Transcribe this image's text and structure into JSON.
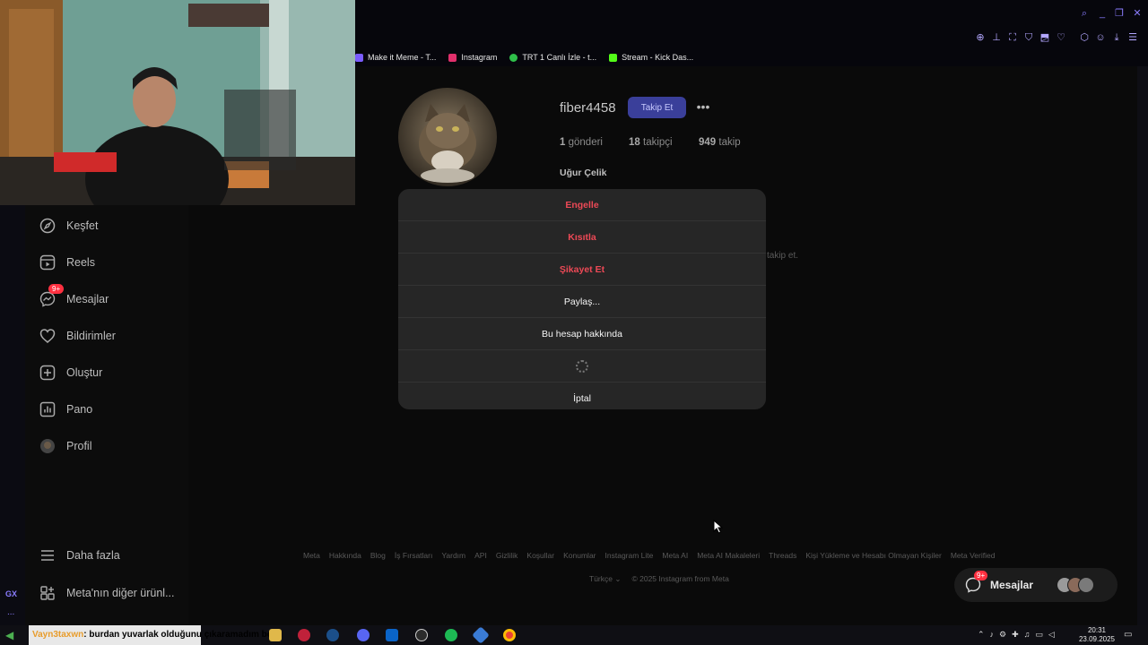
{
  "bookmarks": [
    {
      "label": "Make it Meme - T...",
      "color": "#7a5cff"
    },
    {
      "label": "Instagram",
      "color": "#e1306c"
    },
    {
      "label": "TRT 1 Canlı İzle - t...",
      "color": "#2fbf4a"
    },
    {
      "label": "Stream - Kick Das...",
      "color": "#53fc18"
    }
  ],
  "sidebar": {
    "items": [
      {
        "label": "Keşfet",
        "icon": "compass-icon"
      },
      {
        "label": "Reels",
        "icon": "reels-icon"
      },
      {
        "label": "Mesajlar",
        "icon": "messenger-icon",
        "badge": "9+"
      },
      {
        "label": "Bildirimler",
        "icon": "heart-icon"
      },
      {
        "label": "Oluştur",
        "icon": "plus-square-icon"
      },
      {
        "label": "Pano",
        "icon": "dashboard-icon"
      },
      {
        "label": "Profil",
        "icon": "avatar-icon"
      }
    ],
    "more": "Daha fazla",
    "meta_apps": "Meta'nın diğer ürünl..."
  },
  "profile": {
    "username": "fiber4458",
    "follow_label": "Takip Et",
    "posts_count": "1",
    "posts_label": "gönderi",
    "followers_count": "18",
    "followers_label": "takipçi",
    "following_count": "949",
    "following_label": "takip",
    "full_name": "Uğur Çelik",
    "bg_hint": "takip et."
  },
  "modal": {
    "block": "Engelle",
    "restrict": "Kısıtla",
    "report": "Şikayet Et",
    "share": "Paylaş...",
    "about": "Bu hesap hakkında",
    "cancel": "İptal"
  },
  "footer": {
    "links": [
      "Meta",
      "Hakkında",
      "Blog",
      "İş Fırsatları",
      "Yardım",
      "API",
      "Gizlilik",
      "Koşullar",
      "Konumlar",
      "Instagram Lite",
      "Meta AI",
      "Meta AI Makaleleri",
      "Threads",
      "Kişi Yükleme ve Hesabı Olmayan Kişiler",
      "Meta Verified"
    ],
    "language": "Türkçe",
    "copyright": "© 2025 Instagram from Meta"
  },
  "floating_messages": {
    "label": "Mesajlar",
    "badge": "9+"
  },
  "gx": {
    "logo": "GX",
    "more": "..."
  },
  "ticker": {
    "user": "Vayn3taxwn",
    "text": ": burdan yuvarlak olduğunu çıkaramadım ben"
  },
  "clock": {
    "time": "20:31",
    "date": "23.09.2025"
  },
  "colors": {
    "accent": "#3a3f9a",
    "danger": "#ed4956",
    "modal_bg": "#262626",
    "gx_purple": "#8a7cff"
  }
}
